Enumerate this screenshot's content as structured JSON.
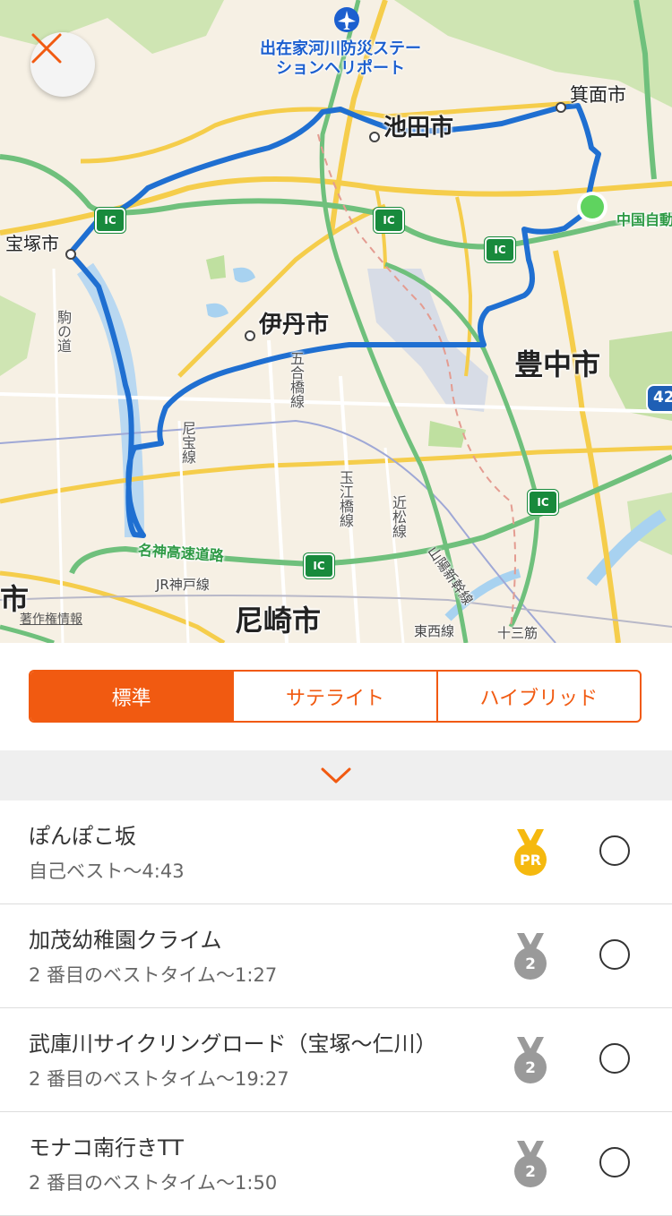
{
  "map": {
    "labels": {
      "heliport": "出在家河川防災ステー\nションヘリポート",
      "ikeda": "池田市",
      "minoh": "箕面市",
      "takarazuka": "宝塚市",
      "itami": "伊丹市",
      "toyonaka": "豊中市",
      "amagasaki": "尼崎市",
      "left_city": "市",
      "chugoku_expy": "中国自動",
      "hanshin_expy": "名神高速道路",
      "jr_kobe": "JR神戸線",
      "sanyo_shinkansen": "山陽新幹線",
      "tozai": "東西線",
      "jusou": "十三筋",
      "gogobashi": "五合橋線",
      "amaho": "尼宝線",
      "tamaebashi": "玉江橋線",
      "chikamatsu": "近松線",
      "komano": "駒の道",
      "route42": "42",
      "copyright": "著作権情報"
    },
    "ic_label": "IC",
    "route_color": "#1f6fd1",
    "start_color": "#5fd35f"
  },
  "map_type": {
    "options": [
      "標準",
      "サテライト",
      "ハイブリッド"
    ],
    "selected": "標準"
  },
  "segments": [
    {
      "name": "ぽんぽこ坂",
      "result": "自己ベスト〜4:43",
      "medal": "PR",
      "selected": false
    },
    {
      "name": "加茂幼稚園クライム",
      "result": "2 番目のベストタイム〜1:27",
      "medal": "2",
      "selected": false
    },
    {
      "name": "武庫川サイクリングロード（宝塚〜仁川）",
      "result": "2 番目のベストタイム〜19:27",
      "medal": "2",
      "selected": false
    },
    {
      "name": "モナコ南行きTT",
      "result": "2 番目のベストタイム〜1:50",
      "medal": "2",
      "selected": false
    }
  ],
  "colors": {
    "accent": "#f15a11",
    "gold": "#f5b90f",
    "silver": "#9a9a9a"
  }
}
